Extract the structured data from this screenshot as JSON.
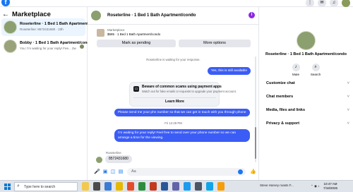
{
  "topbar": {
    "logo": "f",
    "right_icons": [
      "grid-icon",
      "messenger-icon",
      "bell-icon",
      "profile-avatar"
    ]
  },
  "left_panel": {
    "back": "←",
    "title": "Marketplace",
    "conversations": [
      {
        "name": "Roseterline · 1 Bed 1 Bath Apartment/condo",
        "snippet": "Roseterline: 8572431680 · 23h",
        "active": true
      },
      {
        "name": "Bobby · 1 Bed 1 Bath Apartment/condo",
        "snippet": "You: I'm waiting for your reply! Fee... 2w",
        "active": false
      }
    ]
  },
  "chat": {
    "header_name": "Roseterline · 1 Bed 1 Bath Apartment/condo",
    "chevron": "˅",
    "info_icon": "i",
    "listing": {
      "source": "Marketplace",
      "description": "$585 · 1 Bed 1 Bath Apartment/condo",
      "mark_pending": "Mark as pending",
      "more_options": "More options"
    },
    "system_waiting": "Roseterline is waiting for your response.",
    "msg_me_1": "Yes, this is still available",
    "warning": {
      "title": "Beware of common scams using payment apps",
      "body": "Watch out for fake emails or requests to upgrade your payment account.",
      "learn_more": "Learn More"
    },
    "msg_me_2": "Please send me your phn number so that we can get in touch with you through phone",
    "timestamp": "Fri 12:29 PM",
    "msg_me_3": "I'm waiting for your reply! Feel free to send over your phone number so we can arrange a time for the viewing.",
    "them_name": "Roseterline",
    "msg_them_1": "8572431680",
    "composer_placeholder": "Aa"
  },
  "right_panel": {
    "name": "Roseterline · 1 Bed 1 Bath Apartment/condo",
    "actions": [
      {
        "label": "Mute",
        "icon": "bell-icon"
      },
      {
        "label": "Search",
        "icon": "search-icon"
      }
    ],
    "sections": [
      "Customize chat",
      "Chat members",
      "Media, files and links",
      "Privacy & support"
    ]
  },
  "taskbar": {
    "search_placeholder": "Type here to search",
    "news": "Steve Harvey roasts F...",
    "time": "10:47 AM",
    "date": "7/18/2026",
    "colors": {
      "start": "#0078d4"
    }
  }
}
